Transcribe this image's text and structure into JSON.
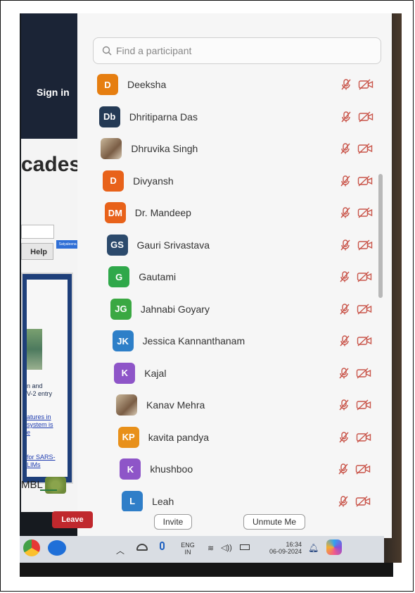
{
  "background_app": {
    "sign_in_label": "Sign in",
    "heading_fragment": "cades",
    "help_label": "Help",
    "tag_chip": "Satyaleena Sa...",
    "card_lines": [
      "n and",
      "V-2 entry"
    ],
    "card_links": [
      "atures in",
      "system is",
      "e",
      "for SARS-",
      "LIMs"
    ],
    "logo_text": "MBL"
  },
  "search": {
    "placeholder": "Find a participant"
  },
  "participants": [
    {
      "name": "Deeksha",
      "initials": "D",
      "color": "#e67e10"
    },
    {
      "name": "Dhritiparna Das",
      "initials": "Db",
      "color": "#243a55"
    },
    {
      "name": "Dhruvika Singh",
      "initials": "",
      "color": "#b89a7a",
      "photo": true
    },
    {
      "name": "Divyansh",
      "initials": "D",
      "color": "#e8621a"
    },
    {
      "name": "Dr. Mandeep",
      "initials": "DM",
      "color": "#e8621a"
    },
    {
      "name": "Gauri Srivastava",
      "initials": "GS",
      "color": "#2c4a6c"
    },
    {
      "name": "Gautami",
      "initials": "G",
      "color": "#2fa84a"
    },
    {
      "name": "Jahnabi Goyary",
      "initials": "JG",
      "color": "#3aa842"
    },
    {
      "name": "Jessica Kannanthanam",
      "initials": "JK",
      "color": "#2d7fc8"
    },
    {
      "name": "Kajal",
      "initials": "K",
      "color": "#8e55c8"
    },
    {
      "name": "Kanav Mehra",
      "initials": "",
      "color": "#7a6a5a",
      "photo": true
    },
    {
      "name": "kavita pandya",
      "initials": "KP",
      "color": "#e8901a"
    },
    {
      "name": "khushboo",
      "initials": "K",
      "color": "#8e55c8"
    },
    {
      "name": "Leah",
      "initials": "L",
      "color": "#2f7ec8"
    }
  ],
  "status_icons": {
    "mic": "mic-off-icon",
    "video": "video-off-icon",
    "color": "#c9554a"
  },
  "actions": {
    "leave_label": "Leave",
    "invite_label": "Invite",
    "unmute_label": "Unmute Me"
  },
  "taskbar": {
    "lang_top": "ENG",
    "lang_bottom": "IN",
    "time": "16:34",
    "date": "06-09-2024"
  }
}
